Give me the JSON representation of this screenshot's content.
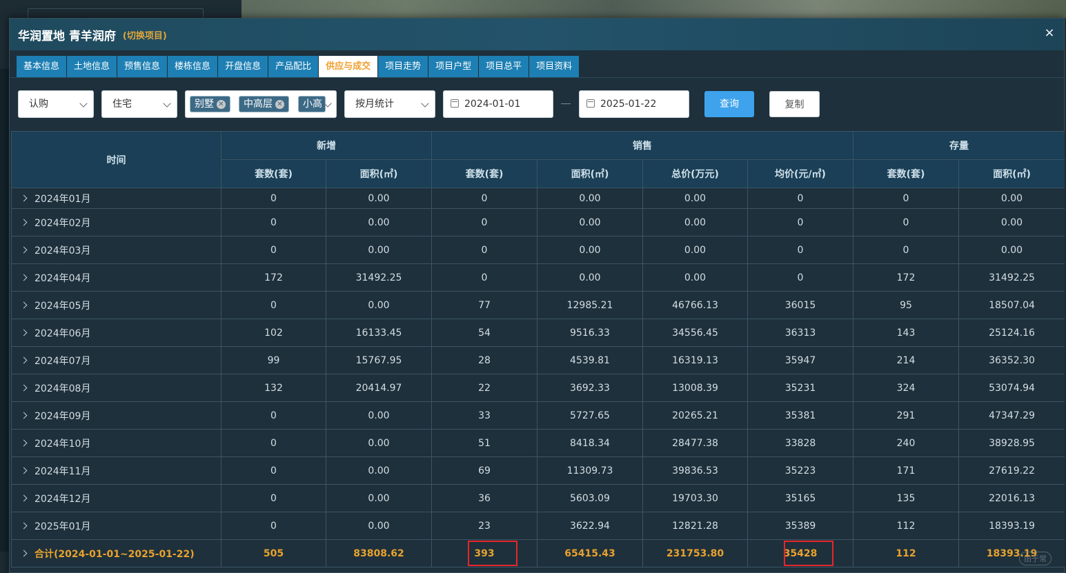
{
  "dialog": {
    "title": "华润置地 青羊润府",
    "switch_label": "(切换项目)",
    "close_icon": "×"
  },
  "tabs": [
    {
      "label": "基本信息",
      "active": false
    },
    {
      "label": "土地信息",
      "active": false
    },
    {
      "label": "预售信息",
      "active": false
    },
    {
      "label": "楼栋信息",
      "active": false
    },
    {
      "label": "开盘信息",
      "active": false
    },
    {
      "label": "产品配比",
      "active": false
    },
    {
      "label": "供应与成交",
      "active": true
    },
    {
      "label": "项目走势",
      "active": false
    },
    {
      "label": "项目户型",
      "active": false
    },
    {
      "label": "项目总平",
      "active": false
    },
    {
      "label": "项目资料",
      "active": false
    }
  ],
  "filters": {
    "type_select": "认购",
    "usage_select": "住宅",
    "product_tags": [
      "别墅",
      "中高层",
      "小高"
    ],
    "stat_select": "按月统计",
    "start_date": "2024-01-01",
    "end_date": "2025-01-22",
    "query_label": "查询",
    "copy_label": "复制"
  },
  "table": {
    "header_time": "时间",
    "group_new": "新增",
    "group_sales": "销售",
    "group_stock": "存量",
    "columns": [
      "套数(套)",
      "面积(㎡)",
      "套数(套)",
      "面积(㎡)",
      "总价(万元)",
      "均价(元/㎡)",
      "套数(套)",
      "面积(㎡)"
    ],
    "rows": [
      {
        "time": "2024年01月",
        "v": [
          "0",
          "0.00",
          "0",
          "0.00",
          "0.00",
          "0",
          "0",
          "0.00"
        ]
      },
      {
        "time": "2024年02月",
        "v": [
          "0",
          "0.00",
          "0",
          "0.00",
          "0.00",
          "0",
          "0",
          "0.00"
        ]
      },
      {
        "time": "2024年03月",
        "v": [
          "0",
          "0.00",
          "0",
          "0.00",
          "0.00",
          "0",
          "0",
          "0.00"
        ]
      },
      {
        "time": "2024年04月",
        "v": [
          "172",
          "31492.25",
          "0",
          "0.00",
          "0.00",
          "0",
          "172",
          "31492.25"
        ]
      },
      {
        "time": "2024年05月",
        "v": [
          "0",
          "0.00",
          "77",
          "12985.21",
          "46766.13",
          "36015",
          "95",
          "18507.04"
        ]
      },
      {
        "time": "2024年06月",
        "v": [
          "102",
          "16133.45",
          "54",
          "9516.33",
          "34556.45",
          "36313",
          "143",
          "25124.16"
        ]
      },
      {
        "time": "2024年07月",
        "v": [
          "99",
          "15767.95",
          "28",
          "4539.81",
          "16319.13",
          "35947",
          "214",
          "36352.30"
        ]
      },
      {
        "time": "2024年08月",
        "v": [
          "132",
          "20414.97",
          "22",
          "3692.33",
          "13008.39",
          "35231",
          "324",
          "53074.94"
        ]
      },
      {
        "time": "2024年09月",
        "v": [
          "0",
          "0.00",
          "33",
          "5727.65",
          "20265.21",
          "35381",
          "291",
          "47347.29"
        ]
      },
      {
        "time": "2024年10月",
        "v": [
          "0",
          "0.00",
          "51",
          "8418.34",
          "28477.38",
          "33828",
          "240",
          "38928.95"
        ]
      },
      {
        "time": "2024年11月",
        "v": [
          "0",
          "0.00",
          "69",
          "11309.73",
          "39836.53",
          "35223",
          "171",
          "27619.22"
        ]
      },
      {
        "time": "2024年12月",
        "v": [
          "0",
          "0.00",
          "36",
          "5603.09",
          "19703.30",
          "35165",
          "135",
          "22016.13"
        ]
      },
      {
        "time": "2025年01月",
        "v": [
          "0",
          "0.00",
          "23",
          "3622.94",
          "12821.28",
          "35389",
          "112",
          "18393.19"
        ]
      }
    ],
    "total": {
      "time": "合计(2024-01-01~2025-01-22)",
      "v": [
        "505",
        "83808.62",
        "393",
        "65415.43",
        "231753.80",
        "35428",
        "112",
        "18393.19"
      ]
    }
  },
  "watermark": "由于常"
}
